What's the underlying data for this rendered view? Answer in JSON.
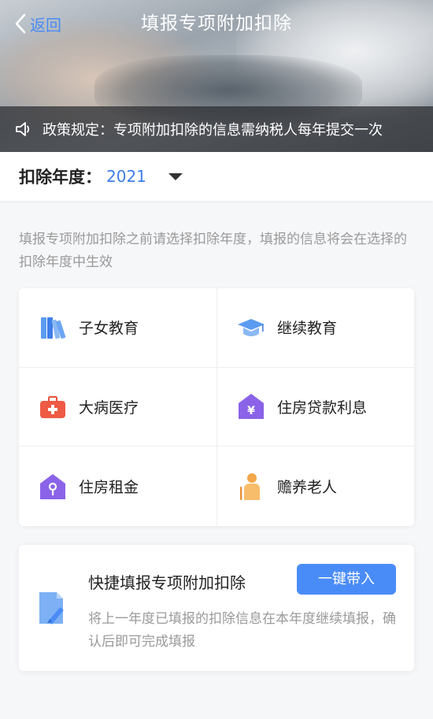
{
  "header": {
    "back_label": "返回",
    "title": "填报专项附加扣除"
  },
  "notice": {
    "text": "政策规定：专项附加扣除的信息需纳税人每年提交一次"
  },
  "year": {
    "label": "扣除年度：",
    "value": "2021"
  },
  "hint": "填报专项附加扣除之前请选择扣除年度，填报的信息将会在选择的扣除年度中生效",
  "items": [
    {
      "label": "子女教育",
      "icon": "books-icon"
    },
    {
      "label": "继续教育",
      "icon": "graduation-cap-icon"
    },
    {
      "label": "大病医疗",
      "icon": "medical-kit-icon"
    },
    {
      "label": "住房贷款利息",
      "icon": "house-yen-icon"
    },
    {
      "label": "住房租金",
      "icon": "house-key-icon"
    },
    {
      "label": "赡养老人",
      "icon": "elderly-icon"
    }
  ],
  "quick": {
    "title": "快捷填报专项附加扣除",
    "button_label": "一键带入",
    "description": "将上一年度已填报的扣除信息在本年度继续填报，确认后即可完成填报"
  },
  "colors": {
    "accent": "#4a8cf7",
    "year_value": "#3f7ee8",
    "hint_text": "#9a9a9a"
  }
}
